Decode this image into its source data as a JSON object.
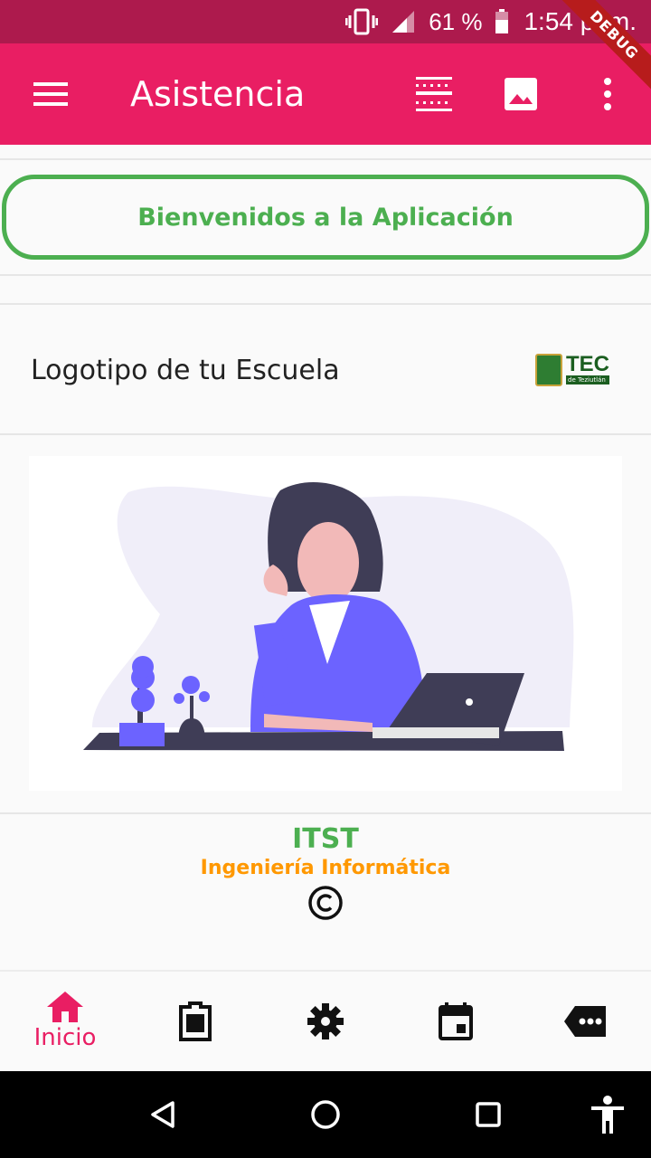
{
  "status_bar": {
    "battery_level": "61 %",
    "time": "1:54 p. m.",
    "icons": [
      "vibrate-icon",
      "signal-icon",
      "battery-icon"
    ]
  },
  "debug_banner": "DEBUG",
  "app_bar": {
    "title": "Asistencia",
    "background_color": "#e91e63",
    "actions": [
      "menu-icon",
      "qr-scan-icon",
      "image-icon",
      "more-vert-icon"
    ]
  },
  "welcome": {
    "text": "Bienvenidos a la Aplicación",
    "border_color": "#4caf50"
  },
  "school_logo": {
    "label": "Logotipo de tu Escuela",
    "logo_text": "TEC",
    "logo_subtext": "de Teziutlán"
  },
  "footer": {
    "org": "ITST",
    "department": "Ingeniería Informática",
    "copyright_icon": "copyright-icon"
  },
  "bottom_nav": {
    "active_label": "Inicio",
    "accent_color": "#e91e63",
    "items": [
      "home-icon",
      "assignment-icon",
      "settings-icon",
      "event-icon",
      "more-label-icon"
    ]
  },
  "system_nav": [
    "back-icon",
    "home-circle-icon",
    "recents-icon",
    "accessibility-icon"
  ]
}
